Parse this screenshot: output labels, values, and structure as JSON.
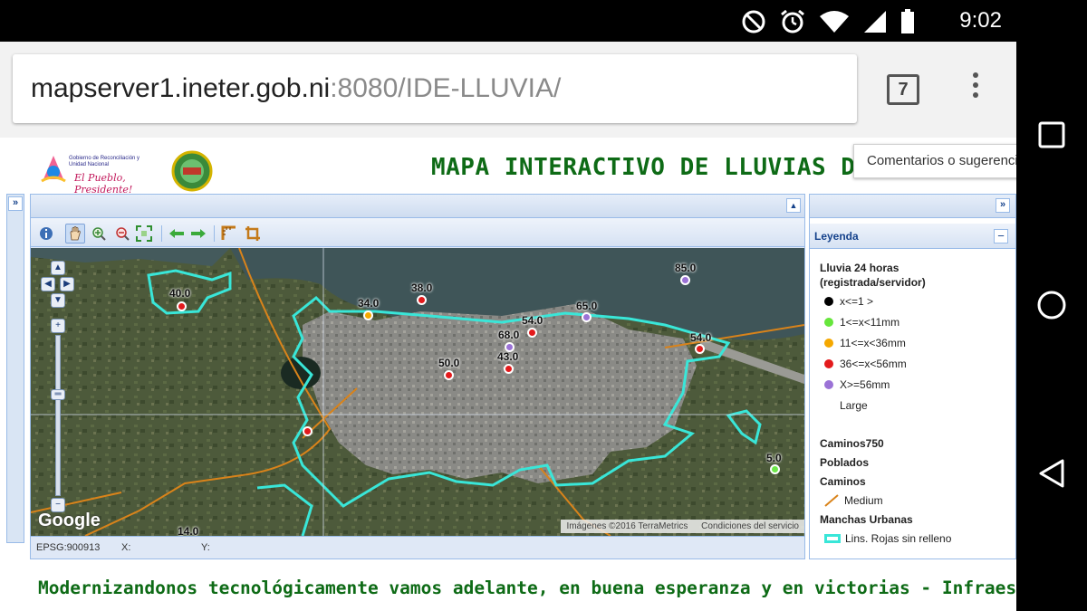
{
  "status_bar": {
    "time": "9:02",
    "icons": [
      "do-not-disturb-icon",
      "alarm-icon",
      "wifi-icon",
      "cell-signal-icon",
      "battery-icon"
    ]
  },
  "browser": {
    "url_host": "mapserver1.ineter.gob.ni",
    "url_path": ":8080/IDE-LLUVIA/",
    "tab_count": "7"
  },
  "page": {
    "title": "MAPA INTERACTIVO DE LLUVIAS DE NICARAGUA",
    "feedback_button": "Comentarios o sugerencias",
    "gov_logo_text": "Gobierno de Reconciliación y Unidad Nacional",
    "gov_logo_slogan": "El Pueblo, Presidente!",
    "footer_text": "Modernizandonos tecnológicamente vamos adelante, en buena esperanza y en victorias - Infraestructura"
  },
  "map": {
    "google_label": "Google",
    "attribution_imagery": "Imágenes ©2016 TerraMetrics",
    "attribution_terms": "Condiciones del servicio",
    "status_projection": "EPSG:900913",
    "status_x_label": "X:",
    "status_y_label": "Y:",
    "stations": [
      {
        "value": "40.0",
        "color": "#e31a1c"
      },
      {
        "value": "34.0",
        "color": "#f5a800"
      },
      {
        "value": "38.0",
        "color": "#e31a1c"
      },
      {
        "value": "85.0",
        "color": "#9b72d6"
      },
      {
        "value": "65.0",
        "color": "#9b72d6"
      },
      {
        "value": "54.0",
        "color": "#e31a1c"
      },
      {
        "value": "68.0",
        "color": "#9b72d6"
      },
      {
        "value": "43.0",
        "color": "#e31a1c"
      },
      {
        "value": "50.0",
        "color": "#e31a1c"
      },
      {
        "value": "54.0",
        "color": "#e31a1c"
      },
      {
        "value": "",
        "color": "#e31a1c"
      },
      {
        "value": "5.0",
        "color": "#6ee84a"
      },
      {
        "value": "14.0",
        "color": "#6ee84a"
      }
    ]
  },
  "legend": {
    "header": "Leyenda",
    "rain_title_1": "Lluvia 24 horas",
    "rain_title_2": "(registrada/servidor)",
    "classes": [
      {
        "label": "x<=1   >",
        "color": "#000000"
      },
      {
        "label": "1<=x<11mm",
        "color": "#66e63c"
      },
      {
        "label": "11<=x<36mm",
        "color": "#f5a800"
      },
      {
        "label": "36<=x<56mm",
        "color": "#e31a1c"
      },
      {
        "label": "X>=56mm",
        "color": "#9b72d6"
      }
    ],
    "large_label": "Large",
    "caminos750": "Caminos750",
    "poblados": "Poblados",
    "caminos": "Caminos",
    "medium_label": "Medium",
    "manchas": "Manchas Urbanas",
    "lineas_label": "Lins. Rojas sin relleno"
  }
}
